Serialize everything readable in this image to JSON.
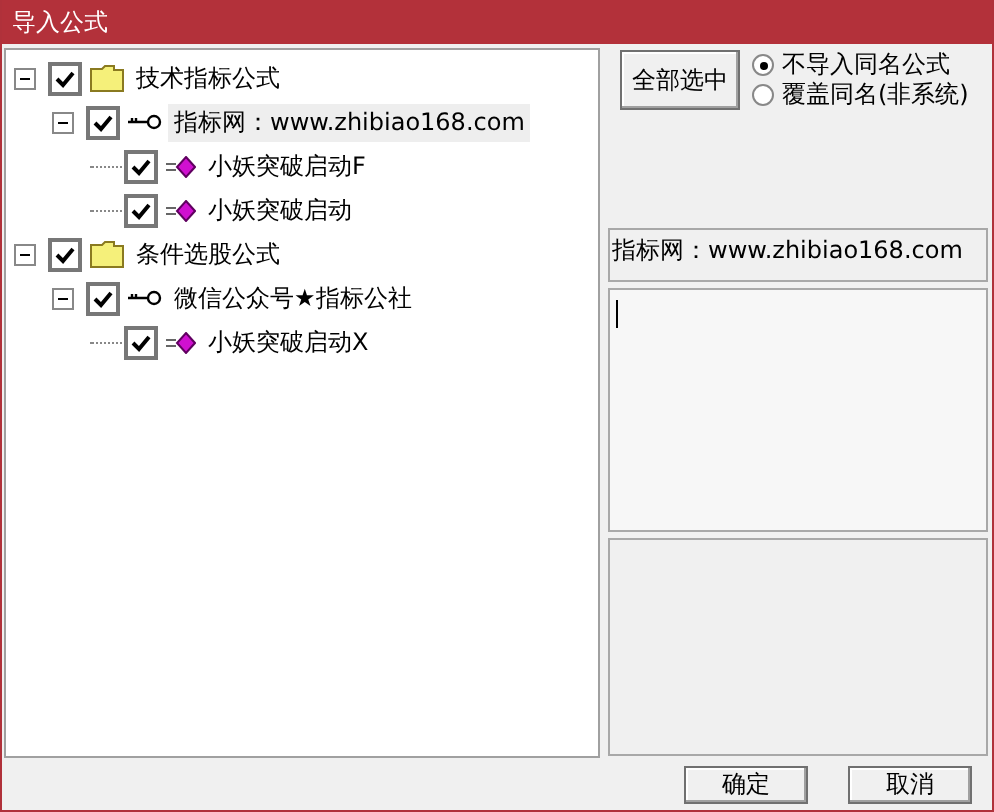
{
  "window": {
    "title": "导入公式"
  },
  "tree": [
    {
      "kind": "folder",
      "label": "技术指标公式",
      "checked": true,
      "expanded": true,
      "selected": false,
      "children": [
        {
          "kind": "group",
          "label": "指标网：www.zhibiao168.com",
          "checked": true,
          "expanded": true,
          "selected": true,
          "children": [
            {
              "kind": "formula",
              "label": "小妖突破启动F",
              "checked": true,
              "selected": false
            },
            {
              "kind": "formula",
              "label": "小妖突破启动",
              "checked": true,
              "selected": false
            }
          ]
        }
      ]
    },
    {
      "kind": "folder",
      "label": "条件选股公式",
      "checked": true,
      "expanded": true,
      "selected": false,
      "children": [
        {
          "kind": "group",
          "label": "微信公众号★指标公社",
          "checked": true,
          "expanded": true,
          "selected": false,
          "children": [
            {
              "kind": "formula",
              "label": "小妖突破启动X",
              "checked": true,
              "selected": false
            }
          ]
        }
      ]
    }
  ],
  "select_all_button": "全部选中",
  "options": [
    {
      "label": "不导入同名公式",
      "selected": true
    },
    {
      "label": "覆盖同名(非系统)",
      "selected": false
    }
  ],
  "info": "指标网：www.zhibiao168.com",
  "buttons": [
    "确定",
    "取消"
  ]
}
